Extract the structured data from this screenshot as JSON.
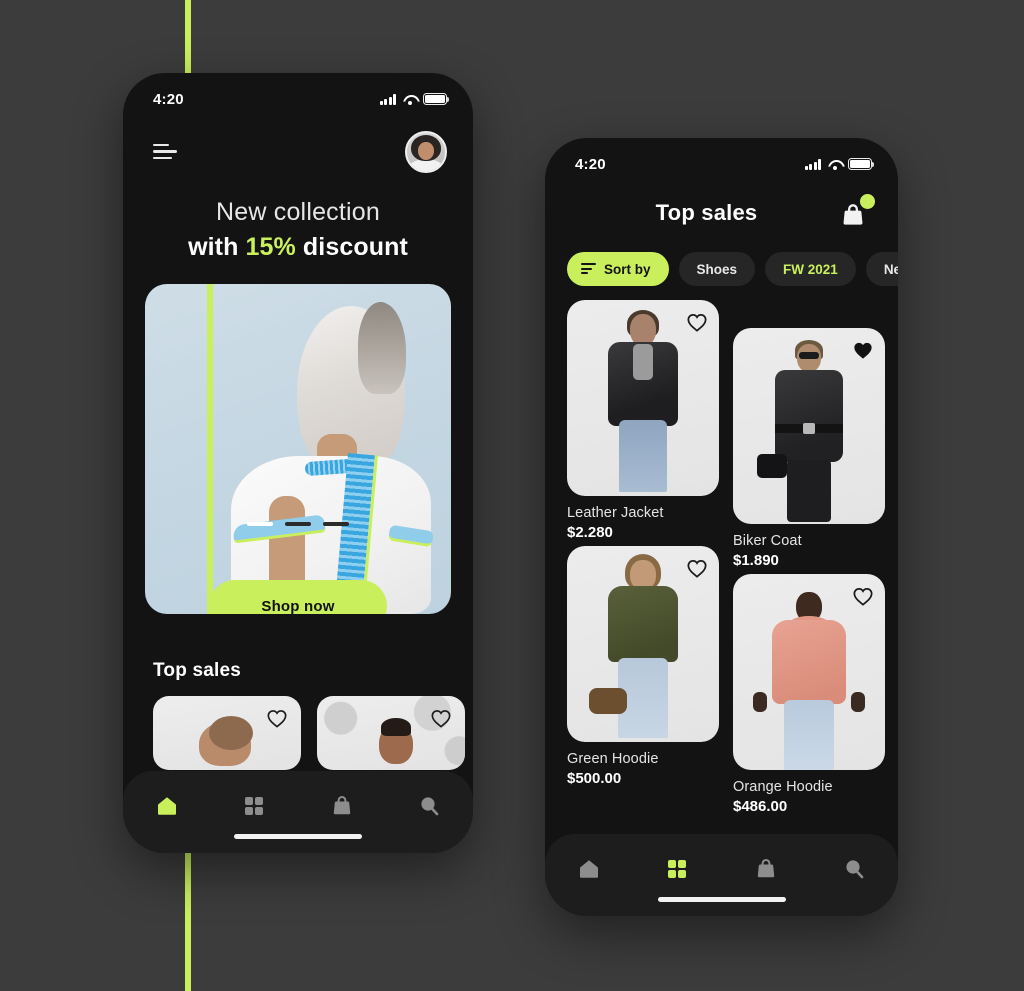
{
  "theme": {
    "accent": "#c9f05c",
    "page_background": "#3c3c3c",
    "phone_background": "#131313",
    "card_background": "#ececec"
  },
  "accent_line": {
    "name": "vertical-lime-guide"
  },
  "left_phone": {
    "status_bar": {
      "time": "4:20",
      "icons": [
        "signal-icon",
        "wifi-icon",
        "battery-icon"
      ]
    },
    "header": {
      "menu_icon": "hamburger-menu-icon",
      "avatar_alt": "user-avatar"
    },
    "headline": {
      "line1": "New collection",
      "line2_prefix": "with ",
      "line2_highlight": "15%",
      "line2_suffix": " discount"
    },
    "hero": {
      "cta_label": "Shop now",
      "carousel": {
        "total": 3,
        "active_index": 0
      }
    },
    "section": {
      "title": "Top sales",
      "mini_cards": [
        {
          "favorite": false
        },
        {
          "favorite": false
        }
      ]
    },
    "nav": {
      "items": [
        {
          "icon": "home-icon",
          "active": true
        },
        {
          "icon": "grid-icon",
          "active": false
        },
        {
          "icon": "bag-icon",
          "active": false
        },
        {
          "icon": "search-icon",
          "active": false
        }
      ]
    }
  },
  "right_phone": {
    "status_bar": {
      "time": "4:20",
      "icons": [
        "signal-icon",
        "wifi-icon",
        "battery-icon"
      ]
    },
    "header": {
      "title": "Top sales",
      "bag_icon": "shopping-bag-icon",
      "bag_badge": true
    },
    "filters": [
      {
        "label": "Sort by",
        "style": "accent",
        "icon": "sort-icon"
      },
      {
        "label": "Shoes",
        "style": "default"
      },
      {
        "label": "FW 2021",
        "style": "lime-text"
      },
      {
        "label": "New",
        "style": "default"
      }
    ],
    "products": [
      {
        "name": "Leather Jacket",
        "price": "$2.280",
        "favorite": false
      },
      {
        "name": "Biker Coat",
        "price": "$1.890",
        "favorite": true
      },
      {
        "name": "Green Hoodie",
        "price": "$500.00",
        "favorite": false
      },
      {
        "name": "Orange Hoodie",
        "price": "$486.00",
        "favorite": false
      }
    ],
    "nav": {
      "items": [
        {
          "icon": "home-icon",
          "active": false
        },
        {
          "icon": "grid-icon",
          "active": true
        },
        {
          "icon": "bag-icon",
          "active": false
        },
        {
          "icon": "search-icon",
          "active": false
        }
      ]
    }
  }
}
